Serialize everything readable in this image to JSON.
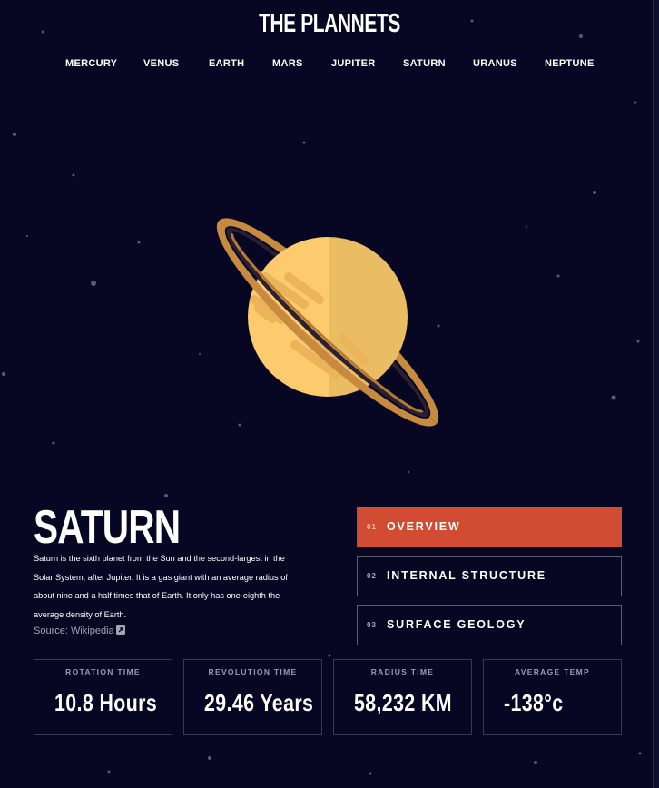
{
  "header": {
    "title": "THE PLANNETS",
    "nav": [
      "MERCURY",
      "VENUS",
      "EARTH",
      "MARS",
      "JUPITER",
      "SATURN",
      "URANUS",
      "NEPTUNE"
    ]
  },
  "planet": {
    "name": "SATURN",
    "description": "Saturn is the sixth planet from the Sun and the second-largest in the Solar System, after Jupiter. It is a gas giant with an average radius of about nine and a half times that of Earth. It only has one-eighth the average density of Earth.",
    "source_prefix": "Source: ",
    "source_link": "Wikipedia"
  },
  "tabs": [
    {
      "num": "01",
      "label": "OVERVIEW",
      "active": true
    },
    {
      "num": "02",
      "label": "INTERNAL STRUCTURE",
      "active": false
    },
    {
      "num": "03",
      "label": "SURFACE GEOLOGY",
      "active": false
    }
  ],
  "stats": [
    {
      "label": "ROTATION TIME",
      "value": "10.8 Hours"
    },
    {
      "label": "REVOLUTION TIME",
      "value": "29.46 Years"
    },
    {
      "label": "RADIUS TIME",
      "value": "58,232 KM"
    },
    {
      "label": "AVERAGE TEMP",
      "value": "-138°c"
    }
  ],
  "colors": {
    "background": "#070724",
    "accent": "#d14c32",
    "planet_light": "#fdcb6e",
    "planet_dark": "#ebbd63",
    "ring": "#c88a3e"
  },
  "icons": {
    "source_link_icon": "external-link-icon"
  }
}
